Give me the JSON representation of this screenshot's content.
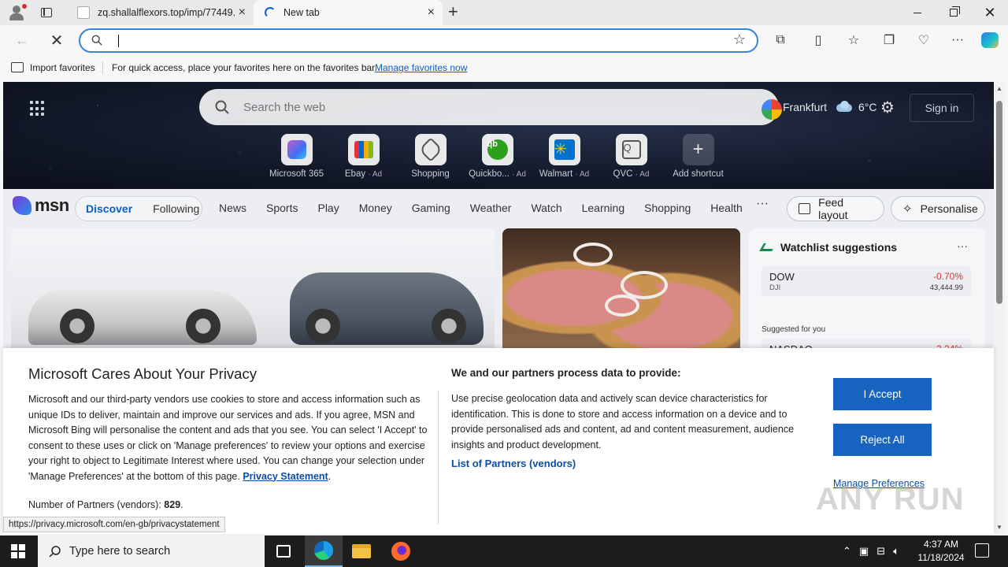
{
  "browser": {
    "tabs": [
      {
        "label": "zq.shallalflexors.top/imp/77449..."
      },
      {
        "label": "New tab"
      }
    ],
    "address_value": "",
    "favorites_bar": {
      "import_label": "Import favorites",
      "message": "For quick access, place your favorites here on the favorites bar.",
      "manage_link": "Manage favorites now"
    }
  },
  "msn": {
    "search_placeholder": "Search the web",
    "weather": {
      "city": "Frankfurt",
      "temp": "6°C"
    },
    "signin_label": "Sign in",
    "shortcuts": [
      {
        "label": "Microsoft 365",
        "ad": "",
        "icon": "microsoft-365-icon"
      },
      {
        "label": "Ebay",
        "ad": "· Ad",
        "icon": "ebay-icon"
      },
      {
        "label": "Shopping",
        "ad": "",
        "icon": "shopping-tag-icon"
      },
      {
        "label": "Quickbo...",
        "ad": "· Ad",
        "icon": "quickbooks-icon"
      },
      {
        "label": "Walmart",
        "ad": "· Ad",
        "icon": "walmart-icon"
      },
      {
        "label": "QVC",
        "ad": "· Ad",
        "icon": "qvc-icon"
      },
      {
        "label": "Add shortcut",
        "ad": "",
        "icon": "plus-icon"
      }
    ],
    "logo_text": "msn",
    "feed_tabs": [
      "Discover",
      "Following"
    ],
    "categories": [
      "News",
      "Sports",
      "Play",
      "Money",
      "Gaming",
      "Weather",
      "Watch",
      "Learning",
      "Shopping",
      "Health"
    ],
    "more_label": "···",
    "feed_layout_label": "Feed layout",
    "personalise_label": "Personalise",
    "watchlist": {
      "title": "Watchlist suggestions",
      "more": "···",
      "stocks": [
        {
          "symbol": "DOW",
          "sub": "DJI",
          "change": "-0.70%",
          "value": "43,444.99"
        },
        {
          "symbol": "NASDAQ",
          "sub": "",
          "change": "-2.24%",
          "value": ""
        }
      ],
      "suggested_label": "Suggested for you"
    }
  },
  "privacy": {
    "title": "Microsoft Cares About Your Privacy",
    "body": "Microsoft and our third-party vendors use cookies to store and access information such as unique IDs to deliver, maintain and improve our services and ads. If you agree, MSN and Microsoft Bing will personalise the content and ads that you see. You can select 'I Accept' to consent to these uses or click on 'Manage preferences' to review your options and exercise your right to object to Legitimate Interest where used.  You can change your selection under 'Manage Preferences' at the bottom of this page.",
    "privacy_link": "Privacy Statement",
    "partners_label": "Number of Partners (vendors):",
    "partners_count": "829",
    "right_title": "We and our partners process data to provide:",
    "right_body": "Use precise geolocation data and actively scan device characteristics for identification. This is done to store and access information on a device and to provide personalised ads and content, ad and content measurement, audience insights and product development.",
    "list_partners": "List of Partners (vendors)",
    "accept": "I Accept",
    "reject": "Reject All",
    "manage": "Manage Preferences"
  },
  "status_url": "https://privacy.microsoft.com/en-gb/privacystatement",
  "watermark": "ANY RUN",
  "taskbar": {
    "search_placeholder": "Type here to search",
    "time": "4:37 AM",
    "date": "11/18/2024"
  },
  "colors": {
    "accent": "#1764c0",
    "link": "#0a4da2",
    "address_focus": "#3b84d8"
  }
}
